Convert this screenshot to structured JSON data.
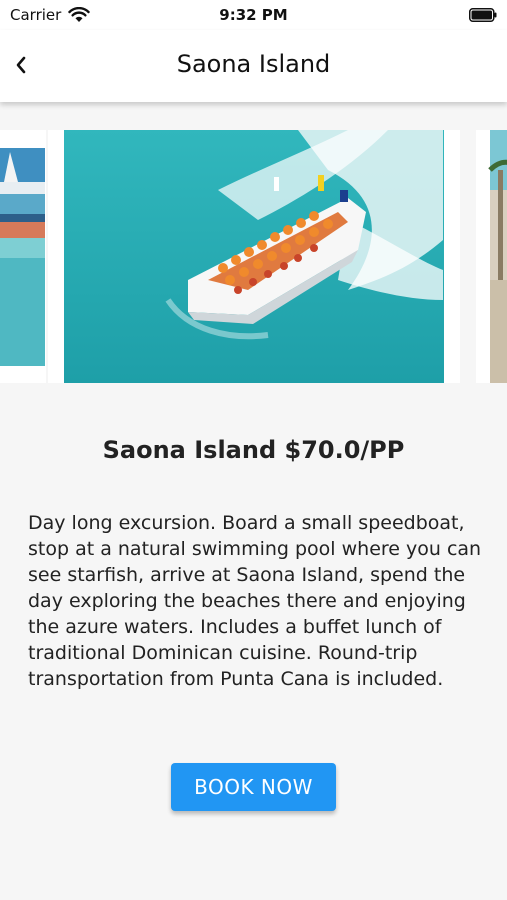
{
  "status_bar": {
    "carrier": "Carrier",
    "time": "9:32 PM",
    "icons": [
      "wifi-icon",
      "battery-icon"
    ]
  },
  "app_bar": {
    "back_icon": "chevron-left-icon",
    "title": "Saona Island"
  },
  "carousel": {
    "images": [
      "catamaran-beach-image",
      "speedboat-image",
      "palm-beach-image"
    ],
    "active_index": 1
  },
  "tour": {
    "heading": "Saona Island $70.0/PP",
    "description": "Day long excursion. Board a small speedboat, stop at a natural swimming pool where you can see starfish, arrive at Saona Island, spend the day exploring the beaches there and enjoying the azure waters. Includes a buffet lunch of traditional Dominican cuisine. Round-trip transportation from Punta Cana is included.",
    "book_label": "BOOK NOW"
  },
  "colors": {
    "accent": "#2196f3",
    "background": "#f6f6f6",
    "water": "#2fb4b9"
  }
}
